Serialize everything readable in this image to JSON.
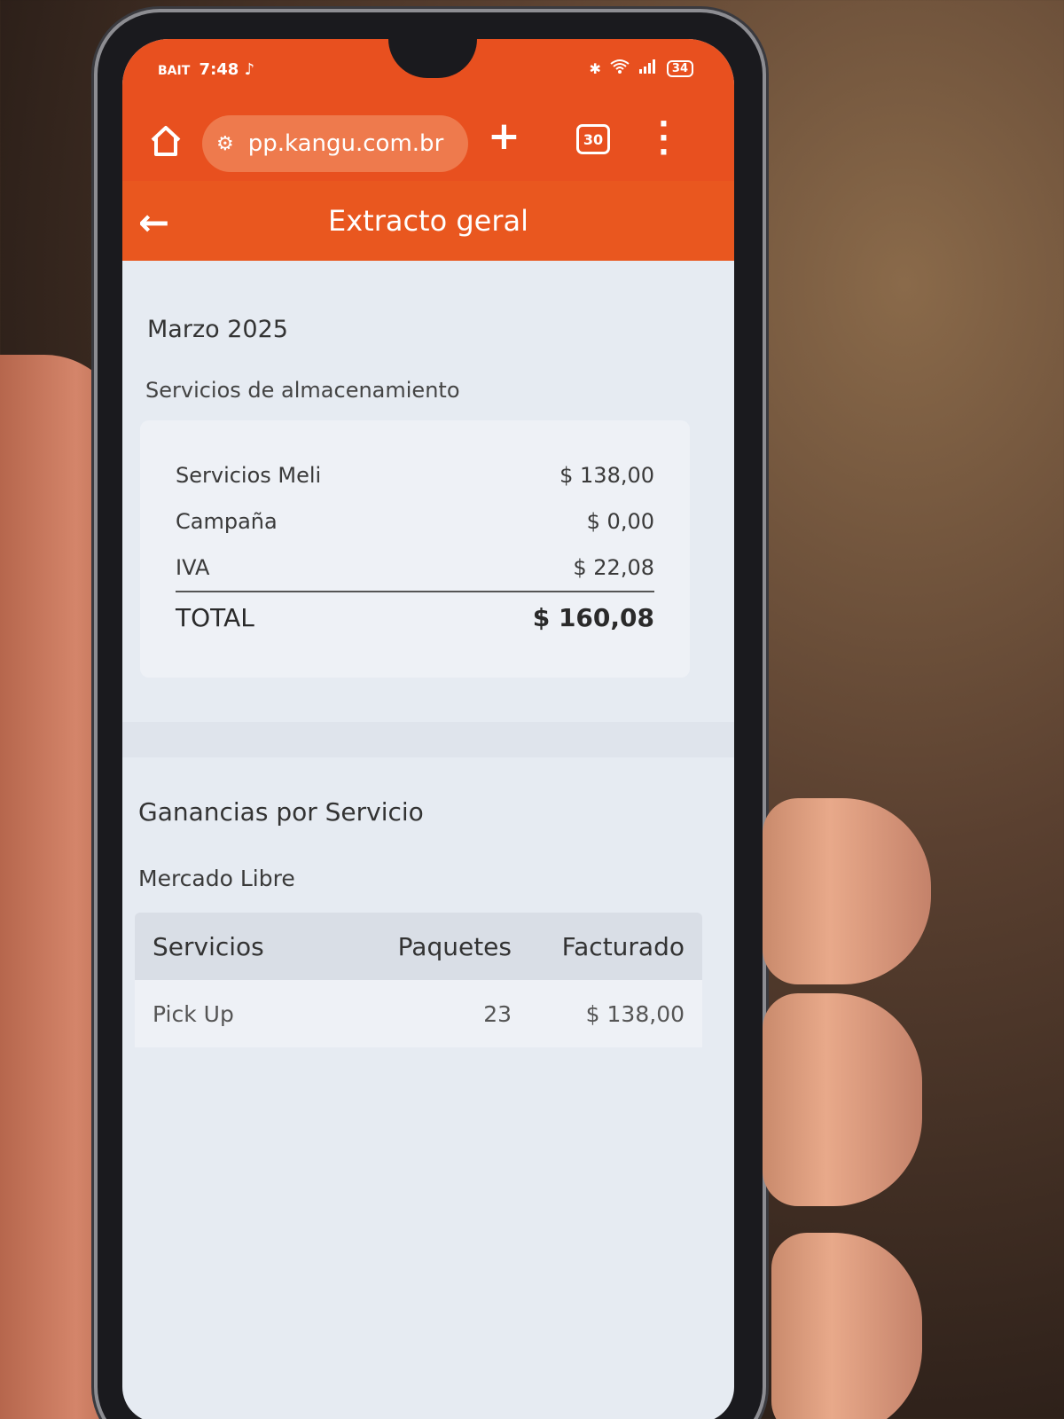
{
  "status_bar": {
    "carrier": "BAIT",
    "time": "7:48",
    "battery": "34"
  },
  "browser": {
    "url": "pp.kangu.com.br",
    "tab_count": "30"
  },
  "app_header": {
    "title": "Extracto geral"
  },
  "summary": {
    "month": "Marzo 2025",
    "section": "Servicios de almacenamiento",
    "rows": [
      {
        "label": "Servicios Meli",
        "amount": "$ 138,00"
      },
      {
        "label": "Campaña",
        "amount": "$ 0,00"
      },
      {
        "label": "IVA",
        "amount": "$ 22,08"
      }
    ],
    "total_label": "TOTAL",
    "total_amount": "$ 160,08"
  },
  "earnings": {
    "title": "Ganancias por Servicio",
    "provider": "Mercado Libre",
    "headers": [
      "Servicios",
      "Paquetes",
      "Facturado"
    ],
    "rows": [
      {
        "service": "Pick Up",
        "packages": "23",
        "billed": "$ 138,00"
      }
    ]
  },
  "colors": {
    "brand_orange": "#e8501f",
    "background": "#e6ebf2"
  },
  "icons": [
    "home-icon",
    "site-settings-icon",
    "plus-icon",
    "tabs-icon",
    "more-vert-icon",
    "back-arrow-icon",
    "bluetooth-icon",
    "wifi-icon",
    "signal-icon",
    "tiktok-icon"
  ]
}
